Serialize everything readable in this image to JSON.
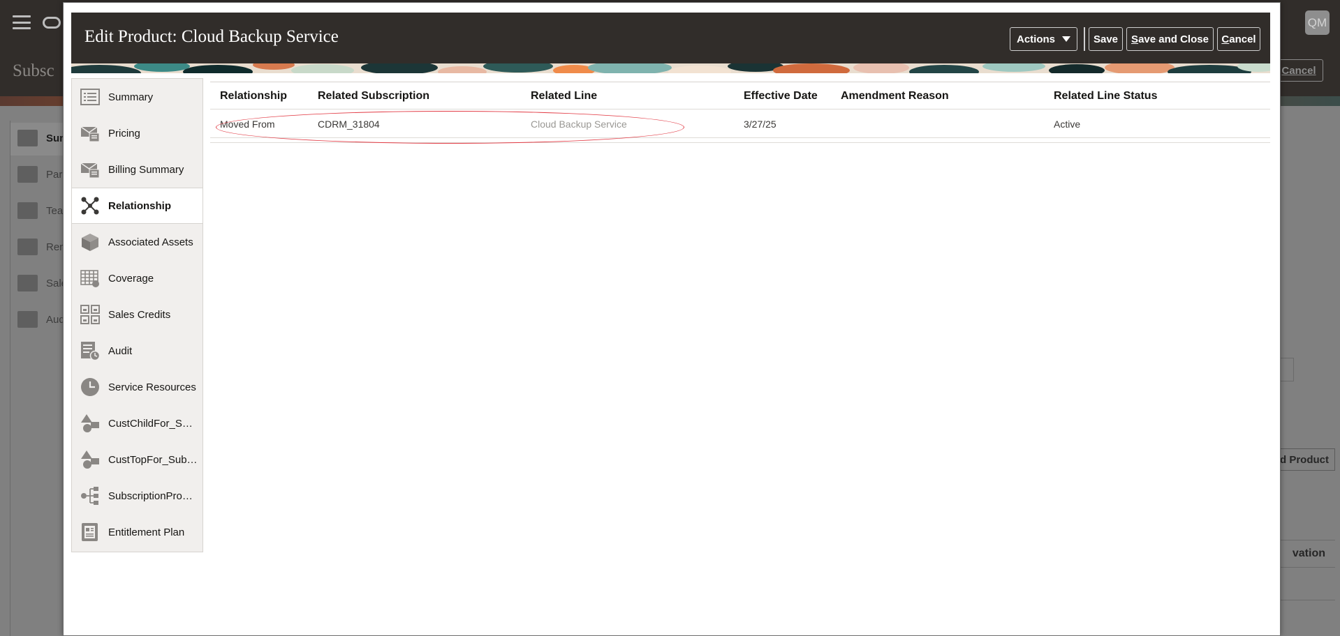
{
  "background": {
    "avatar_initials": "QM",
    "page_title_partial": "Subsc",
    "cancel_label_partial": "Cancel",
    "nav_items": [
      {
        "label": "Sum",
        "icon": "summary-icon"
      },
      {
        "label": "Par",
        "icon": "parties-icon"
      },
      {
        "label": "Tea",
        "icon": "team-icon"
      },
      {
        "label": "Ren",
        "icon": "renewal-icon"
      },
      {
        "label": "Sale",
        "icon": "sales-credits-icon"
      },
      {
        "label": "Aud",
        "icon": "audit-icon"
      }
    ],
    "add_product_partial": "d Product",
    "activation_header_partial": "vation"
  },
  "dialog": {
    "title": "Edit Product: Cloud Backup Service",
    "buttons": {
      "actions": "Actions",
      "save": "Save",
      "save_and_close_mnemonic": "S",
      "save_and_close_rest": "ave and Close",
      "cancel_mnemonic": "C",
      "cancel_rest": "ancel"
    }
  },
  "sidenav": {
    "items": [
      {
        "label": "Summary",
        "icon": "summary-list-icon",
        "active": false
      },
      {
        "label": "Pricing",
        "icon": "pricing-envelope-icon",
        "active": false
      },
      {
        "label": "Billing Summary",
        "icon": "billing-envelope-icon",
        "active": false
      },
      {
        "label": "Relationship",
        "icon": "relationship-network-icon",
        "active": true
      },
      {
        "label": "Associated Assets",
        "icon": "cube-icon",
        "active": false
      },
      {
        "label": "Coverage",
        "icon": "coverage-grid-icon",
        "active": false
      },
      {
        "label": "Sales Credits",
        "icon": "sales-credits-icon",
        "active": false
      },
      {
        "label": "Audit",
        "icon": "audit-clock-icon",
        "active": false
      },
      {
        "label": "Service Resources",
        "icon": "clock-icon",
        "active": false
      },
      {
        "label": "CustChildFor_S…",
        "icon": "shapes-icon",
        "active": false
      },
      {
        "label": "CustTopFor_Sub…",
        "icon": "shapes-icon",
        "active": false
      },
      {
        "label": "SubscriptionPro…",
        "icon": "hierarchy-icon",
        "active": false
      },
      {
        "label": "Entitlement Plan",
        "icon": "entitlement-icon",
        "active": false
      }
    ]
  },
  "table": {
    "columns": [
      "Relationship",
      "Related Subscription",
      "Related Line",
      "Effective Date",
      "Amendment Reason",
      "Related Line Status"
    ],
    "rows": [
      {
        "relationship": "Moved From",
        "related_subscription": "CDRM_31804",
        "related_line": "Cloud Backup Service",
        "effective_date": "3/27/25",
        "amendment_reason": "",
        "related_line_status": "Active"
      }
    ]
  },
  "colors": {
    "header_bg": "#312d2a",
    "highlight_ellipse": "#e23a44",
    "muted_link": "#9a9894"
  }
}
